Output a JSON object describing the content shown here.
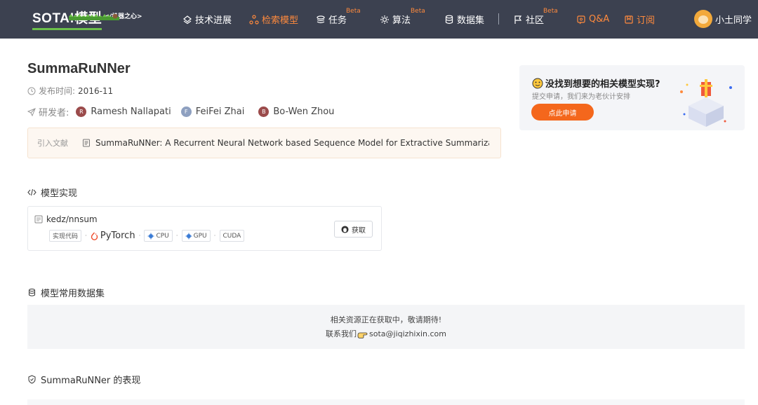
{
  "nav": {
    "logo_main": "SOTA!模型",
    "logo_sub": "</机器之心>",
    "items": [
      {
        "label": "技术进展",
        "icon": "layers-icon",
        "beta": ""
      },
      {
        "label": "检索模型",
        "icon": "nodes-icon",
        "beta": ""
      },
      {
        "label": "任务",
        "icon": "stack-icon",
        "beta": "Beta"
      },
      {
        "label": "算法",
        "icon": "gear-icon",
        "beta": "Beta"
      },
      {
        "label": "数据集",
        "icon": "database-icon",
        "beta": ""
      },
      {
        "label": "社区",
        "icon": "flag-icon",
        "beta": "Beta"
      },
      {
        "label": "Q&A",
        "icon": "qa-icon",
        "beta": ""
      },
      {
        "label": "订阅",
        "icon": "bookmark-icon",
        "beta": ""
      }
    ],
    "username": "小土同学",
    "accent_color": "#ff8a3d"
  },
  "model": {
    "title": "SummaRuNNer",
    "publish_label": "发布时间:",
    "publish_date": "2016-11",
    "authors_label": "研发者:",
    "authors": [
      {
        "initial": "R",
        "name": "Ramesh Nallapati",
        "color": "#9b4b4b"
      },
      {
        "initial": "F",
        "name": "FeiFei Zhai",
        "color": "#8ea0c0"
      },
      {
        "initial": "B",
        "name": "Bo-Wen Zhou",
        "color": "#9b4b4b"
      }
    ],
    "cite_label": "引入文献",
    "cite_text": "SummaRuNNer: A Recurrent Neural Network based Sequence Model for Extractive Summarization of ⋯"
  },
  "promo": {
    "title": "没找到想要的相关模型实现?",
    "subtitle": "提交申请，我们来为老伙计安排",
    "button": "点此申请"
  },
  "implementation": {
    "section_title": "模型实现",
    "repo": "kedz/nnsum",
    "tag_code": "实现代码",
    "framework": "PyTorch",
    "tag_cpu": "CPU",
    "tag_gpu": "GPU",
    "tag_cuda": "CUDA",
    "sep": "·",
    "get_button": "获取"
  },
  "datasets": {
    "section_title": "模型常用数据集",
    "message": "相关资源正在获取中，敬请期待!",
    "contact_label": "联系我们",
    "contact_email": "sota@jiqizhixin.com"
  },
  "performance": {
    "section_title": "SummaRuNNer 的表现"
  }
}
